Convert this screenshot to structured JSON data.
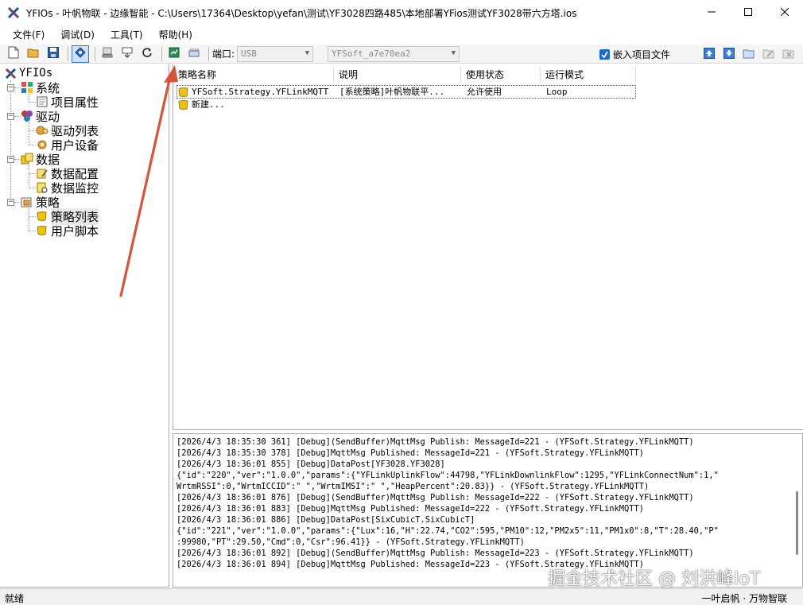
{
  "window": {
    "title": "YFIOs - 叶帆物联 - 边缘智能 - C:\\Users\\17364\\Desktop\\yefan\\测试\\YF3028四路485\\本地部署YFios测试YF3028带六方塔.ios",
    "minimize_icon": "minimize-icon",
    "maximize_icon": "maximize-icon",
    "close_icon": "close-icon"
  },
  "menu": [
    {
      "label": "文件(F)"
    },
    {
      "label": "调试(D)"
    },
    {
      "label": "工具(T)"
    },
    {
      "label": "帮助(H)"
    }
  ],
  "toolbar": {
    "port_label": "端口:",
    "port_value": "USB",
    "device_value": "YFSoft_a7e70ea2",
    "embed_label": "嵌入项目文件",
    "embed_checked": true
  },
  "tree": {
    "root": "YFIOs",
    "nodes": [
      {
        "label": "系统",
        "children": [
          "项目属性"
        ]
      },
      {
        "label": "驱动",
        "children": [
          "驱动列表",
          "用户设备"
        ]
      },
      {
        "label": "数据",
        "children": [
          "数据配置",
          "数据监控"
        ]
      },
      {
        "label": "策略",
        "children": [
          "策略列表",
          "用户脚本"
        ]
      }
    ],
    "selected": "策略列表"
  },
  "strategy_table": {
    "columns": [
      "策略名称",
      "说明",
      "使用状态",
      "运行模式"
    ],
    "rows": [
      [
        "YFSoft.Strategy.YFLinkMQTT",
        "[系统策略]叶帆物联平...",
        "允许使用",
        "Loop"
      ],
      [
        "新建...",
        "",
        "",
        ""
      ]
    ]
  },
  "log": [
    "[2026/4/3 18:35:30 361] [Debug](SendBuffer)MqttMsg Publish: MessageId=221 - (YFSoft.Strategy.YFLinkMQTT)",
    "[2026/4/3 18:35:30 378] [Debug]MqttMsg Published: MessageId=221 - (YFSoft.Strategy.YFLinkMQTT)",
    "[2026/4/3 18:36:01 855] [Debug]DataPost[YF3028.YF3028]",
    "{\"id\":\"220\",\"ver\":\"1.0.0\",\"params\":{\"YFLinkUplinkFlow\":44798,\"YFLinkDownlinkFlow\":1295,\"YFLinkConnectNum\":1,\"",
    "WrtmRSSI\":0,\"WrtmICCID\":\" \",\"WrtmIMSI\":\" \",\"HeapPercent\":20.83}} - (YFSoft.Strategy.YFLinkMQTT)",
    "[2026/4/3 18:36:01 876] [Debug](SendBuffer)MqttMsg Publish: MessageId=222 - (YFSoft.Strategy.YFLinkMQTT)",
    "[2026/4/3 18:36:01 883] [Debug]MqttMsg Published: MessageId=222 - (YFSoft.Strategy.YFLinkMQTT)",
    "[2026/4/3 18:36:01 886] [Debug]DataPost[SixCubicT.SixCubicT]",
    "{\"id\":\"221\",\"ver\":\"1.0.0\",\"params\":{\"Lux\":16,\"H\":22.74,\"CO2\":595,\"PM10\":12,\"PM2x5\":11,\"PM1x0\":8,\"T\":28.40,\"P\"",
    ":99980,\"PT\":29.50,\"Cmd\":0,\"Csr\":96.41}} - (YFSoft.Strategy.YFLinkMQTT)",
    "[2026/4/3 18:36:01 892] [Debug](SendBuffer)MqttMsg Publish: MessageId=223 - (YFSoft.Strategy.YFLinkMQTT)",
    "[2026/4/3 18:36:01 894] [Debug]MqttMsg Published: MessageId=223 - (YFSoft.Strategy.YFLinkMQTT)"
  ],
  "status": {
    "left": "就绪",
    "right": "一叶启帆 · 万物智联"
  },
  "watermark": "掘金技术社区 @ 刘洪峰IoT",
  "colors": {
    "annotation_arrow": "#d9533a",
    "accent": "#1a6bd0"
  }
}
